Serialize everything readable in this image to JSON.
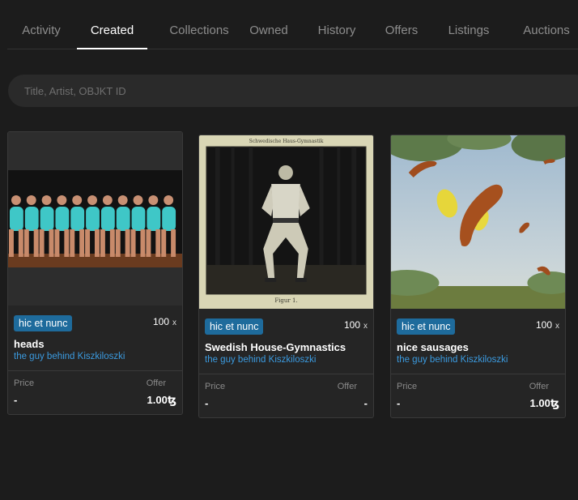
{
  "tabs": [
    {
      "label": "Activity",
      "active": false
    },
    {
      "label": "Created",
      "active": true
    },
    {
      "label": "Collections",
      "active": false
    },
    {
      "label": "Owned",
      "active": false
    },
    {
      "label": "History",
      "active": false
    },
    {
      "label": "Offers",
      "active": false
    },
    {
      "label": "Listings",
      "active": false
    },
    {
      "label": "Auctions",
      "active": false
    }
  ],
  "search": {
    "placeholder": "Title, Artist, OBJKT ID",
    "value": ""
  },
  "cards": [
    {
      "image_icon": "gymnasts-row-artwork",
      "platform": "hic et nunc",
      "editions": "100",
      "editions_suffix": "x",
      "title": "heads",
      "creator": "the guy behind Kiszkiloszki",
      "price_label": "Price",
      "price_value": "-",
      "offer_label": "Offer",
      "offer_value": "1.00ꜩ"
    },
    {
      "image_icon": "gymnastics-engraving-artwork",
      "image_caption_top": "Schwedische Haus-Gymnastik",
      "image_caption_bottom": "Figur 1.",
      "platform": "hic et nunc",
      "editions": "100",
      "editions_suffix": "x",
      "title": "Swedish House-Gymnastics",
      "creator": "the guy behind Kiszkiloszki",
      "price_label": "Price",
      "price_value": "-",
      "offer_label": "Offer",
      "offer_value": "-"
    },
    {
      "image_icon": "flying-sausages-artwork",
      "platform": "hic et nunc",
      "editions": "100",
      "editions_suffix": "x",
      "title": "nice sausages",
      "creator": "the guy behind Kiszkiloszki",
      "price_label": "Price",
      "price_value": "-",
      "offer_label": "Offer",
      "offer_value": "1.00ꜩ"
    }
  ],
  "colors": {
    "background": "#1c1c1c",
    "card": "#252525",
    "badge": "#1e6b9c",
    "link": "#3b9be0"
  }
}
